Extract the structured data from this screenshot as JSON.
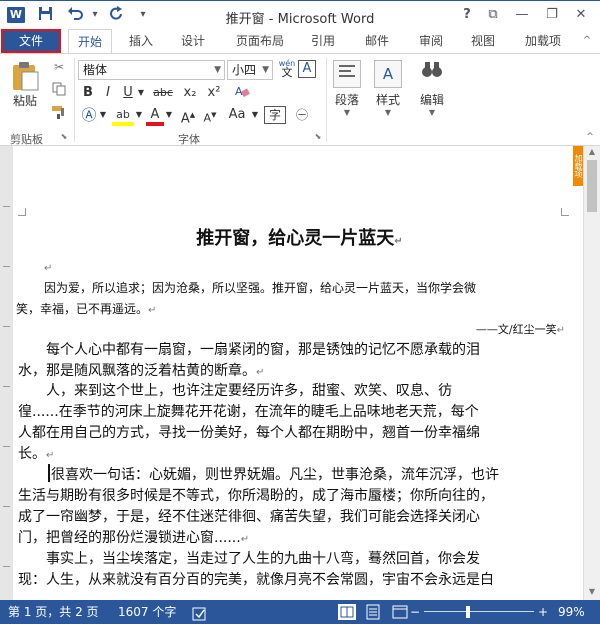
{
  "window": {
    "title": "推开窗 - Microsoft Word",
    "logo": "W",
    "qat": {
      "save_icon": "save-icon",
      "undo_icon": "undo-icon",
      "redo_icon": "redo-icon",
      "customize": "▾"
    },
    "controls": {
      "help": "?",
      "ribbon_display": "⧉",
      "minimize": "—",
      "restore": "❐",
      "close": "✕"
    }
  },
  "tabs": [
    "文件",
    "开始",
    "插入",
    "设计",
    "页面布局",
    "引用",
    "邮件",
    "审阅",
    "视图",
    "加载项"
  ],
  "ribbon": {
    "clipboard": {
      "paste_label": "粘贴",
      "group_label": "剪贴板"
    },
    "font": {
      "font_name": "楷体",
      "font_size": "小四",
      "wen_label": "wén",
      "bold": "B",
      "italic": "I",
      "underline": "U",
      "strike": "abc",
      "subscript": "x₂",
      "superscript": "x²",
      "group_label": "字体",
      "grow": "A",
      "shrink": "A",
      "case": "Aa",
      "highlight": "ab",
      "color": "A"
    },
    "paragraph": {
      "label": "段落"
    },
    "styles": {
      "label": "样式"
    },
    "editing": {
      "label": "编辑"
    }
  },
  "document": {
    "title": "推开窗，给心灵一片蓝天",
    "intro_line1": "因为爱，所以追求；因为沧桑，所以坚强。推开窗，给心灵一片蓝天，当你学会微",
    "intro_line2": "笑，幸福，已不再遥远。",
    "signature": "——文/红尘一笑",
    "p1_line1": "每个人心中都有一扇窗，一扇紧闭的窗，那是锈蚀的记忆不愿承载的泪",
    "p1_line2": "水，那是随风飘落的泛着枯黄的断章。",
    "p2_line1": "人，来到这个世上，也许注定要经历许多，甜蜜、欢笑、叹息、彷",
    "p2_line2": "徨......在季节的河床上旋舞花开花谢，在流年的睫毛上品味地老天荒，每个",
    "p2_line3": "人都在用自己的方式，寻找一份美好，每个人都在期盼中，翘首一份幸福绵",
    "p2_line4": "长。",
    "p3_line1": "很喜欢一句话：心妩媚，则世界妩媚。凡尘，世事沧桑，流年沉浮，也许",
    "p3_line2": "生活与期盼有很多时候是不等式，你所渴盼的，成了海市蜃楼；你所向往的，",
    "p3_line3": "成了一帘幽梦，于是，经不住迷茫徘徊、痛苦失望，我们可能会选择关闭心",
    "p3_line4": "门，把曾经的那份烂漫锁进心窗......",
    "p4_line1": "事实上，当尘埃落定，当走过了人生的九曲十八弯，蓦然回首，你会发",
    "p4_line2": "现：人生，从来就没有百分百的完美，就像月亮不会常圆，宇宙不会永远是白",
    "side_tag": "加载项"
  },
  "statusbar": {
    "page": "第 1 页，共 2 页",
    "words": "1607 个字",
    "zoom": "99%",
    "zoom_minus": "−",
    "zoom_plus": "+"
  },
  "colors": {
    "accent": "#2b579a",
    "highlight_red": "#e0161c"
  }
}
